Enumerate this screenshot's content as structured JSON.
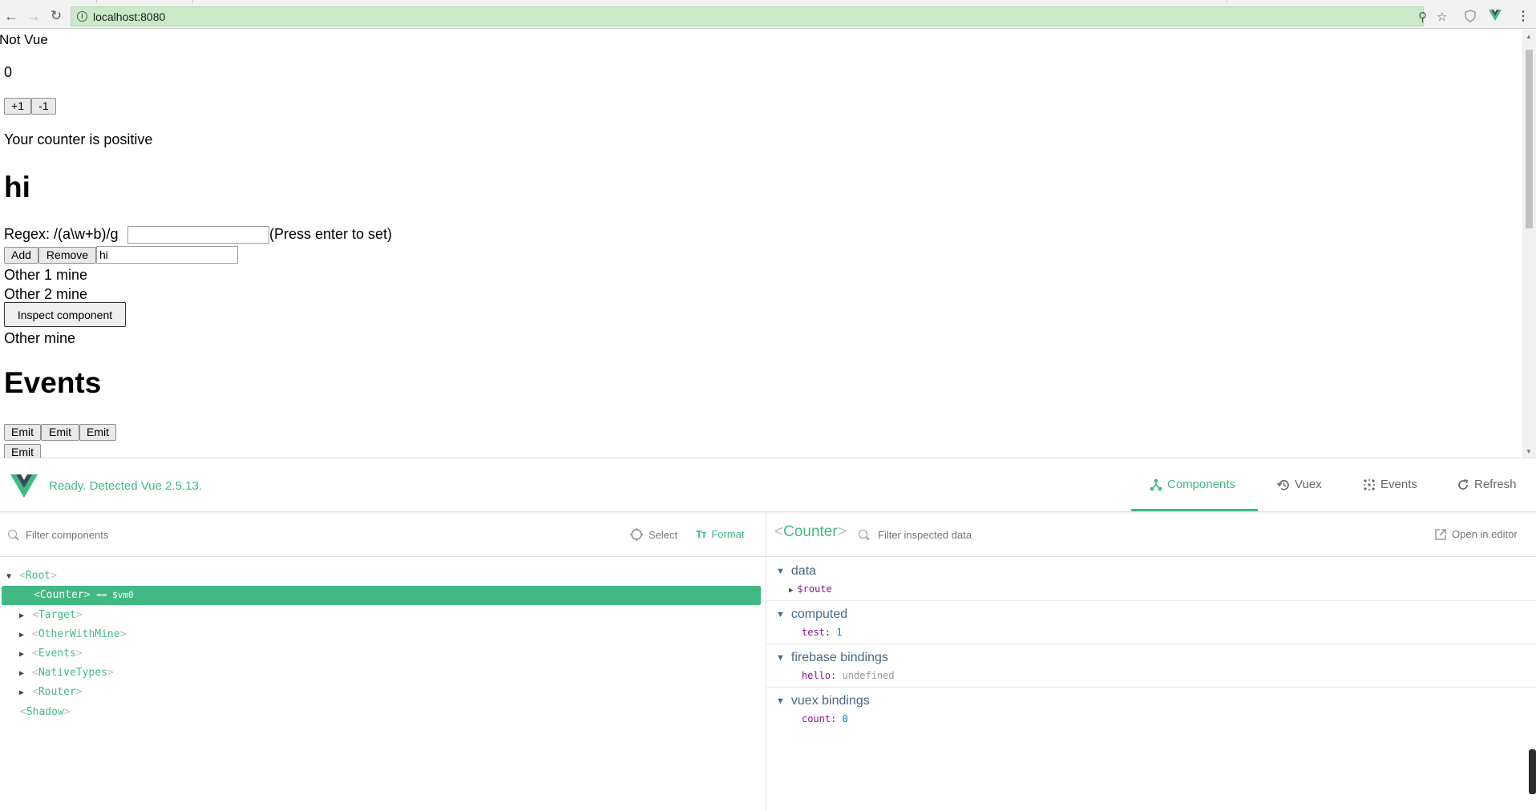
{
  "browser": {
    "url": "localhost:8080"
  },
  "page": {
    "title_partial": "Not Vue",
    "counter_value": "0",
    "plus_label": "+1",
    "minus_label": "-1",
    "counter_status": "Your counter is positive",
    "heading_hi": "hi",
    "regex_label": "Regex: /(a\\w+b)/g",
    "regex_value": "",
    "regex_hint": "(Press enter to set)",
    "add_label": "Add",
    "remove_label": "Remove",
    "item_input_value": "hi",
    "items": [
      "Other 1 mine",
      "Other 2 mine"
    ],
    "inspect_label": "Inspect component",
    "other_mine": "Other mine",
    "events_heading": "Events",
    "emit_label": "Emit"
  },
  "devtools": {
    "status": "Ready. Detected Vue 2.5.13.",
    "tabs": [
      {
        "label": "Components",
        "icon": "components-icon",
        "active": true
      },
      {
        "label": "Vuex",
        "icon": "history-icon",
        "active": false
      },
      {
        "label": "Events",
        "icon": "events-icon",
        "active": false
      },
      {
        "label": "Refresh",
        "icon": "refresh-icon",
        "active": false
      }
    ],
    "left": {
      "filter_placeholder": "Filter components",
      "select_label": "Select",
      "format_label": "Format",
      "tree": [
        {
          "name": "Root",
          "expanded": true,
          "depth": 0
        },
        {
          "name": "Counter",
          "suffix": "== $vm0",
          "selected": true,
          "depth": 1
        },
        {
          "name": "Target",
          "collapsed": true,
          "depth": 1
        },
        {
          "name": "OtherWithMine",
          "collapsed": true,
          "depth": 1
        },
        {
          "name": "Events",
          "collapsed": true,
          "depth": 1
        },
        {
          "name": "NativeTypes",
          "collapsed": true,
          "depth": 1
        },
        {
          "name": "Router",
          "collapsed": true,
          "depth": 1
        },
        {
          "name": "Shadow",
          "depth": 0
        }
      ]
    },
    "right": {
      "component_name": "Counter",
      "filter_placeholder": "Filter inspected data",
      "open_in_editor": "Open in editor",
      "sections": [
        {
          "title": "data",
          "props": [
            {
              "key": "$route",
              "value": "",
              "expandable": true
            }
          ]
        },
        {
          "title": "computed",
          "props": [
            {
              "key": "test:",
              "value": "1"
            }
          ]
        },
        {
          "title": "firebase bindings",
          "props": [
            {
              "key": "hello:",
              "value": "undefined"
            }
          ]
        },
        {
          "title": "vuex bindings",
          "props": [
            {
              "key": "count:",
              "value": "0"
            }
          ]
        }
      ]
    }
  },
  "colors": {
    "vue_green": "#42b983",
    "omnibox_green": "#c9e9c7",
    "section_title": "#486887"
  }
}
